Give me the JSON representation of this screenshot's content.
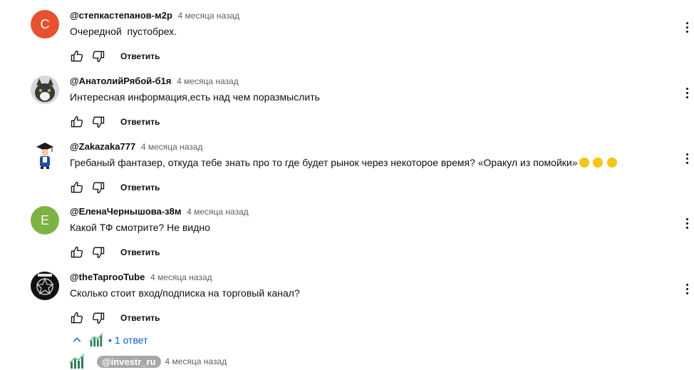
{
  "comments": [
    {
      "author": "@степкастепанов-м2р",
      "time": "4 месяца назад",
      "text": "Очередной  пустобрех.",
      "avatar_letter": "С",
      "avatar_color": "#e8512f",
      "reply_label": "Ответить"
    },
    {
      "author": "@АнатолийРябой-б1я",
      "time": "4 месяца назад",
      "text": "Интересная информация,есть над чем поразмыслить",
      "avatar_letter": "",
      "avatar_color": "#8c8c8c",
      "reply_label": "Ответить"
    },
    {
      "author": "@Zakazaka777",
      "time": "4 месяца назад",
      "text": "Гребаный фантазер, откуда тебе знать про то где будет рынок через некоторое время? «Оракул из помойки»",
      "avatar_letter": "",
      "avatar_color": "#ffffff",
      "reply_label": "Ответить"
    },
    {
      "author": "@ЕленаЧернышова-з8м",
      "time": "4 месяца назад",
      "text": "Какой ТФ смотрите? Не видно",
      "avatar_letter": "Е",
      "avatar_color": "#7cb342",
      "reply_label": "Ответить"
    },
    {
      "author": "@theTaprooTube",
      "time": "4 месяца назад",
      "text": "Сколько стоит вход/подписка на торговый канал?",
      "avatar_letter": "",
      "avatar_color": "#111111",
      "reply_label": "Ответить"
    }
  ],
  "replies_toggle": {
    "label": "1 ответ",
    "bullet": "•"
  },
  "reply_preview": {
    "author": "@investr_ru",
    "time": "4 месяца назад"
  },
  "accent_color": "#065fd4"
}
